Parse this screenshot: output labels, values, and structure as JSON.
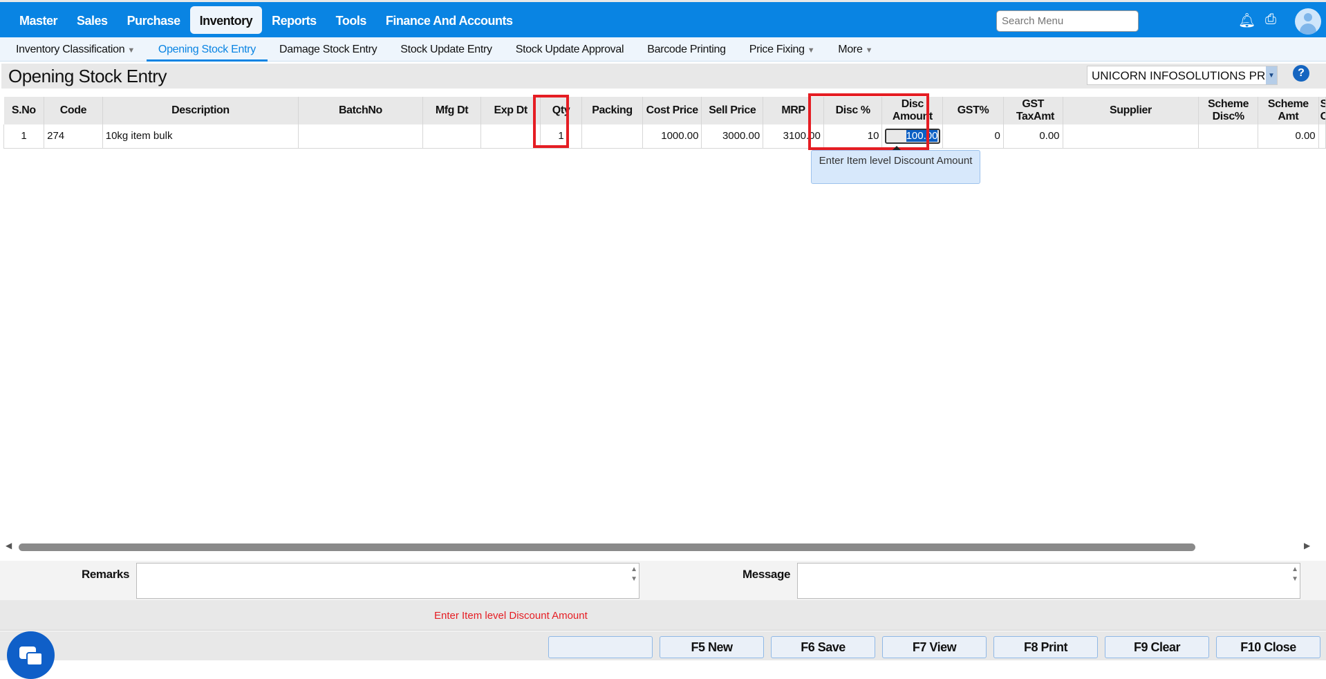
{
  "topnav": {
    "items": [
      "Master",
      "Sales",
      "Purchase",
      "Inventory",
      "Reports",
      "Tools",
      "Finance And Accounts"
    ],
    "active": "Inventory",
    "search_placeholder": "Search Menu"
  },
  "subnav": {
    "items": [
      {
        "label": "Inventory Classification",
        "dropdown": true
      },
      {
        "label": "Opening Stock Entry",
        "dropdown": false
      },
      {
        "label": "Damage Stock Entry",
        "dropdown": false
      },
      {
        "label": "Stock Update Entry",
        "dropdown": false
      },
      {
        "label": "Stock Update Approval",
        "dropdown": false
      },
      {
        "label": "Barcode Printing",
        "dropdown": false
      },
      {
        "label": "Price Fixing",
        "dropdown": true
      },
      {
        "label": "More",
        "dropdown": true
      }
    ]
  },
  "page": {
    "title": "Opening Stock Entry",
    "company": "UNICORN INFOSOLUTIONS PR",
    "help": "?"
  },
  "table": {
    "headers": [
      "S.No",
      "Code",
      "Description",
      "BatchNo",
      "Mfg Dt",
      "Exp Dt",
      "Qty",
      "Packing",
      "Cost Price",
      "Sell Price",
      "MRP",
      "Disc %",
      "Disc Amount",
      "GST%",
      "GST TaxAmt",
      "Supplier",
      "Scheme Disc%",
      "Scheme Amt",
      "Sc O"
    ],
    "rows": [
      {
        "sno": "1",
        "code": "274",
        "description": "10kg item bulk",
        "batch": "",
        "mfg": "",
        "exp": "",
        "qty": "1",
        "packing": "",
        "cost": "1000.00",
        "sell": "3000.00",
        "mrp": "3100.00",
        "disc_pct": "10",
        "disc_amt": "100.00",
        "gst_pct": "0",
        "gst_tax": "0.00",
        "supplier": "",
        "scheme_disc": "",
        "scheme_amt": "0.00"
      }
    ]
  },
  "tooltip": "Enter Item level Discount Amount",
  "footer": {
    "remarks_label": "Remarks",
    "message_label": "Message",
    "status_message": "Enter Item level Discount Amount",
    "buttons": [
      "",
      "F5 New",
      "F6 Save",
      "F7 View",
      "F8 Print",
      "F9 Clear",
      "F10 Close"
    ]
  }
}
